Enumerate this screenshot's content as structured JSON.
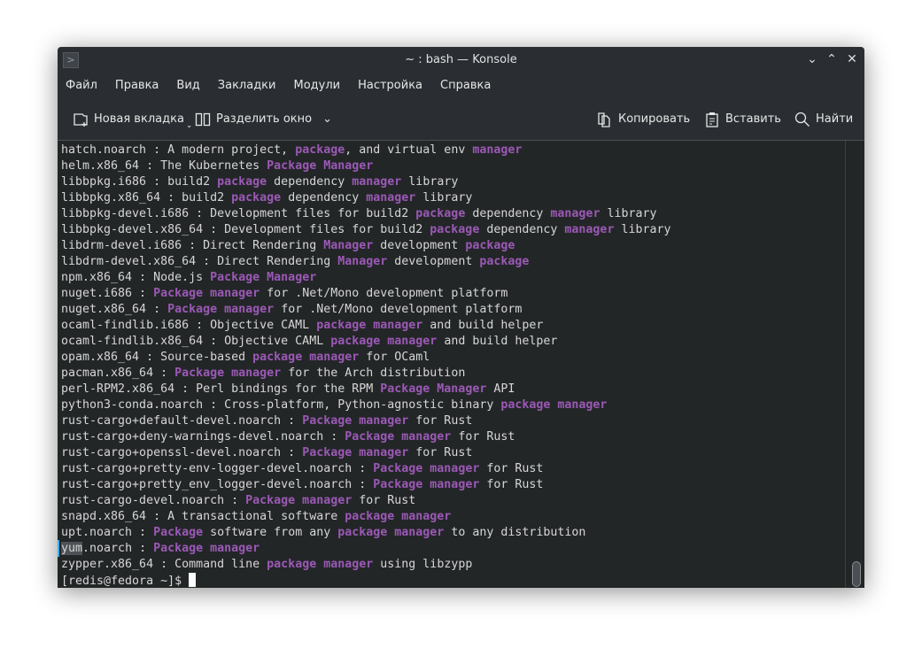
{
  "window": {
    "title": "~ : bash — Konsole"
  },
  "menu": [
    "Файл",
    "Правка",
    "Вид",
    "Закладки",
    "Модули",
    "Настройка",
    "Справка"
  ],
  "toolbar": {
    "new_tab": "Новая вкладка",
    "split": "Разделить окно",
    "copy": "Копировать",
    "paste": "Вставить",
    "find": "Найти"
  },
  "colors": {
    "highlight": "#9b59b6",
    "terminal_bg": "#232627",
    "chrome_bg": "#2a2e32"
  },
  "terminal": {
    "lines": [
      [
        [
          "hatch.noarch : A modern project, ",
          0
        ],
        [
          "package",
          1
        ],
        [
          ", and virtual env ",
          0
        ],
        [
          "manager",
          1
        ]
      ],
      [
        [
          "helm.x86_64 : The Kubernetes ",
          0
        ],
        [
          "Package Manager",
          1
        ]
      ],
      [
        [
          "libbpkg.i686 : build2 ",
          0
        ],
        [
          "package",
          1
        ],
        [
          " dependency ",
          0
        ],
        [
          "manager",
          1
        ],
        [
          " library",
          0
        ]
      ],
      [
        [
          "libbpkg.x86_64 : build2 ",
          0
        ],
        [
          "package",
          1
        ],
        [
          " dependency ",
          0
        ],
        [
          "manager",
          1
        ],
        [
          " library",
          0
        ]
      ],
      [
        [
          "libbpkg-devel.i686 : Development files for build2 ",
          0
        ],
        [
          "package",
          1
        ],
        [
          " dependency ",
          0
        ],
        [
          "manager",
          1
        ],
        [
          " library",
          0
        ]
      ],
      [
        [
          "libbpkg-devel.x86_64 : Development files for build2 ",
          0
        ],
        [
          "package",
          1
        ],
        [
          " dependency ",
          0
        ],
        [
          "manager",
          1
        ],
        [
          " library",
          0
        ]
      ],
      [
        [
          "libdrm-devel.i686 : Direct Rendering ",
          0
        ],
        [
          "Manager",
          1
        ],
        [
          " development ",
          0
        ],
        [
          "package",
          1
        ]
      ],
      [
        [
          "libdrm-devel.x86_64 : Direct Rendering ",
          0
        ],
        [
          "Manager",
          1
        ],
        [
          " development ",
          0
        ],
        [
          "package",
          1
        ]
      ],
      [
        [
          "npm.x86_64 : Node.js ",
          0
        ],
        [
          "Package Manager",
          1
        ]
      ],
      [
        [
          "nuget.i686 : ",
          0
        ],
        [
          "Package manager",
          1
        ],
        [
          " for .Net/Mono development platform",
          0
        ]
      ],
      [
        [
          "nuget.x86_64 : ",
          0
        ],
        [
          "Package manager",
          1
        ],
        [
          " for .Net/Mono development platform",
          0
        ]
      ],
      [
        [
          "ocaml-findlib.i686 : Objective CAML ",
          0
        ],
        [
          "package manager",
          1
        ],
        [
          " and build helper",
          0
        ]
      ],
      [
        [
          "ocaml-findlib.x86_64 : Objective CAML ",
          0
        ],
        [
          "package manager",
          1
        ],
        [
          " and build helper",
          0
        ]
      ],
      [
        [
          "opam.x86_64 : Source-based ",
          0
        ],
        [
          "package manager",
          1
        ],
        [
          " for OCaml",
          0
        ]
      ],
      [
        [
          "pacman.x86_64 : ",
          0
        ],
        [
          "Package manager",
          1
        ],
        [
          " for the Arch distribution",
          0
        ]
      ],
      [
        [
          "perl-RPM2.x86_64 : Perl bindings for the RPM ",
          0
        ],
        [
          "Package Manager",
          1
        ],
        [
          " API",
          0
        ]
      ],
      [
        [
          "python3-conda.noarch : Cross-platform, Python-agnostic binary ",
          0
        ],
        [
          "package manager",
          1
        ]
      ],
      [
        [
          "rust-cargo+default-devel.noarch : ",
          0
        ],
        [
          "Package manager",
          1
        ],
        [
          " for Rust",
          0
        ]
      ],
      [
        [
          "rust-cargo+deny-warnings-devel.noarch : ",
          0
        ],
        [
          "Package manager",
          1
        ],
        [
          " for Rust",
          0
        ]
      ],
      [
        [
          "rust-cargo+openssl-devel.noarch : ",
          0
        ],
        [
          "Package manager",
          1
        ],
        [
          " for Rust",
          0
        ]
      ],
      [
        [
          "rust-cargo+pretty-env-logger-devel.noarch : ",
          0
        ],
        [
          "Package manager",
          1
        ],
        [
          " for Rust",
          0
        ]
      ],
      [
        [
          "rust-cargo+pretty_env_logger-devel.noarch : ",
          0
        ],
        [
          "Package manager",
          1
        ],
        [
          " for Rust",
          0
        ]
      ],
      [
        [
          "rust-cargo-devel.noarch : ",
          0
        ],
        [
          "Package manager",
          1
        ],
        [
          " for Rust",
          0
        ]
      ],
      [
        [
          "snapd.x86_64 : A transactional software ",
          0
        ],
        [
          "package manager",
          1
        ]
      ],
      [
        [
          "upt.noarch : ",
          0
        ],
        [
          "Package",
          1
        ],
        [
          " software from any ",
          0
        ],
        [
          "package manager",
          1
        ],
        [
          " to any distribution",
          0
        ]
      ],
      [
        [
          "yum",
          2
        ],
        [
          ".noarch : ",
          0
        ],
        [
          "Package manager",
          1
        ]
      ],
      [
        [
          "zypper.x86_64 : Command line ",
          0
        ],
        [
          "package manager",
          1
        ],
        [
          " using libzypp",
          0
        ]
      ]
    ],
    "prompt": "[redis@fedora ~]$ "
  }
}
